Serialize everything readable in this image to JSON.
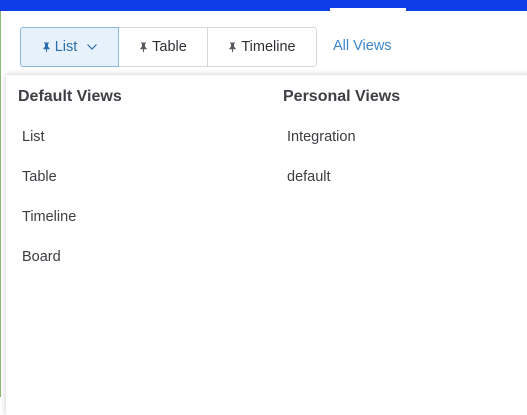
{
  "view_bar": {
    "list_label": "List",
    "table_label": "Table",
    "timeline_label": "Timeline",
    "all_views_label": "All Views"
  },
  "dropdown": {
    "default_title": "Default Views",
    "default_items": [
      "List",
      "Table",
      "Timeline",
      "Board"
    ],
    "personal_title": "Personal Views",
    "personal_items": [
      "Integration",
      "default"
    ]
  },
  "colors": {
    "top_bar": "#0f3de6",
    "accent_link": "#3d86cc",
    "active_button_bg": "#e6f1fb",
    "active_button_border": "#8bb8de"
  },
  "icons": {
    "pin": "pin-icon",
    "dropdown": "chevron-down-icon"
  }
}
